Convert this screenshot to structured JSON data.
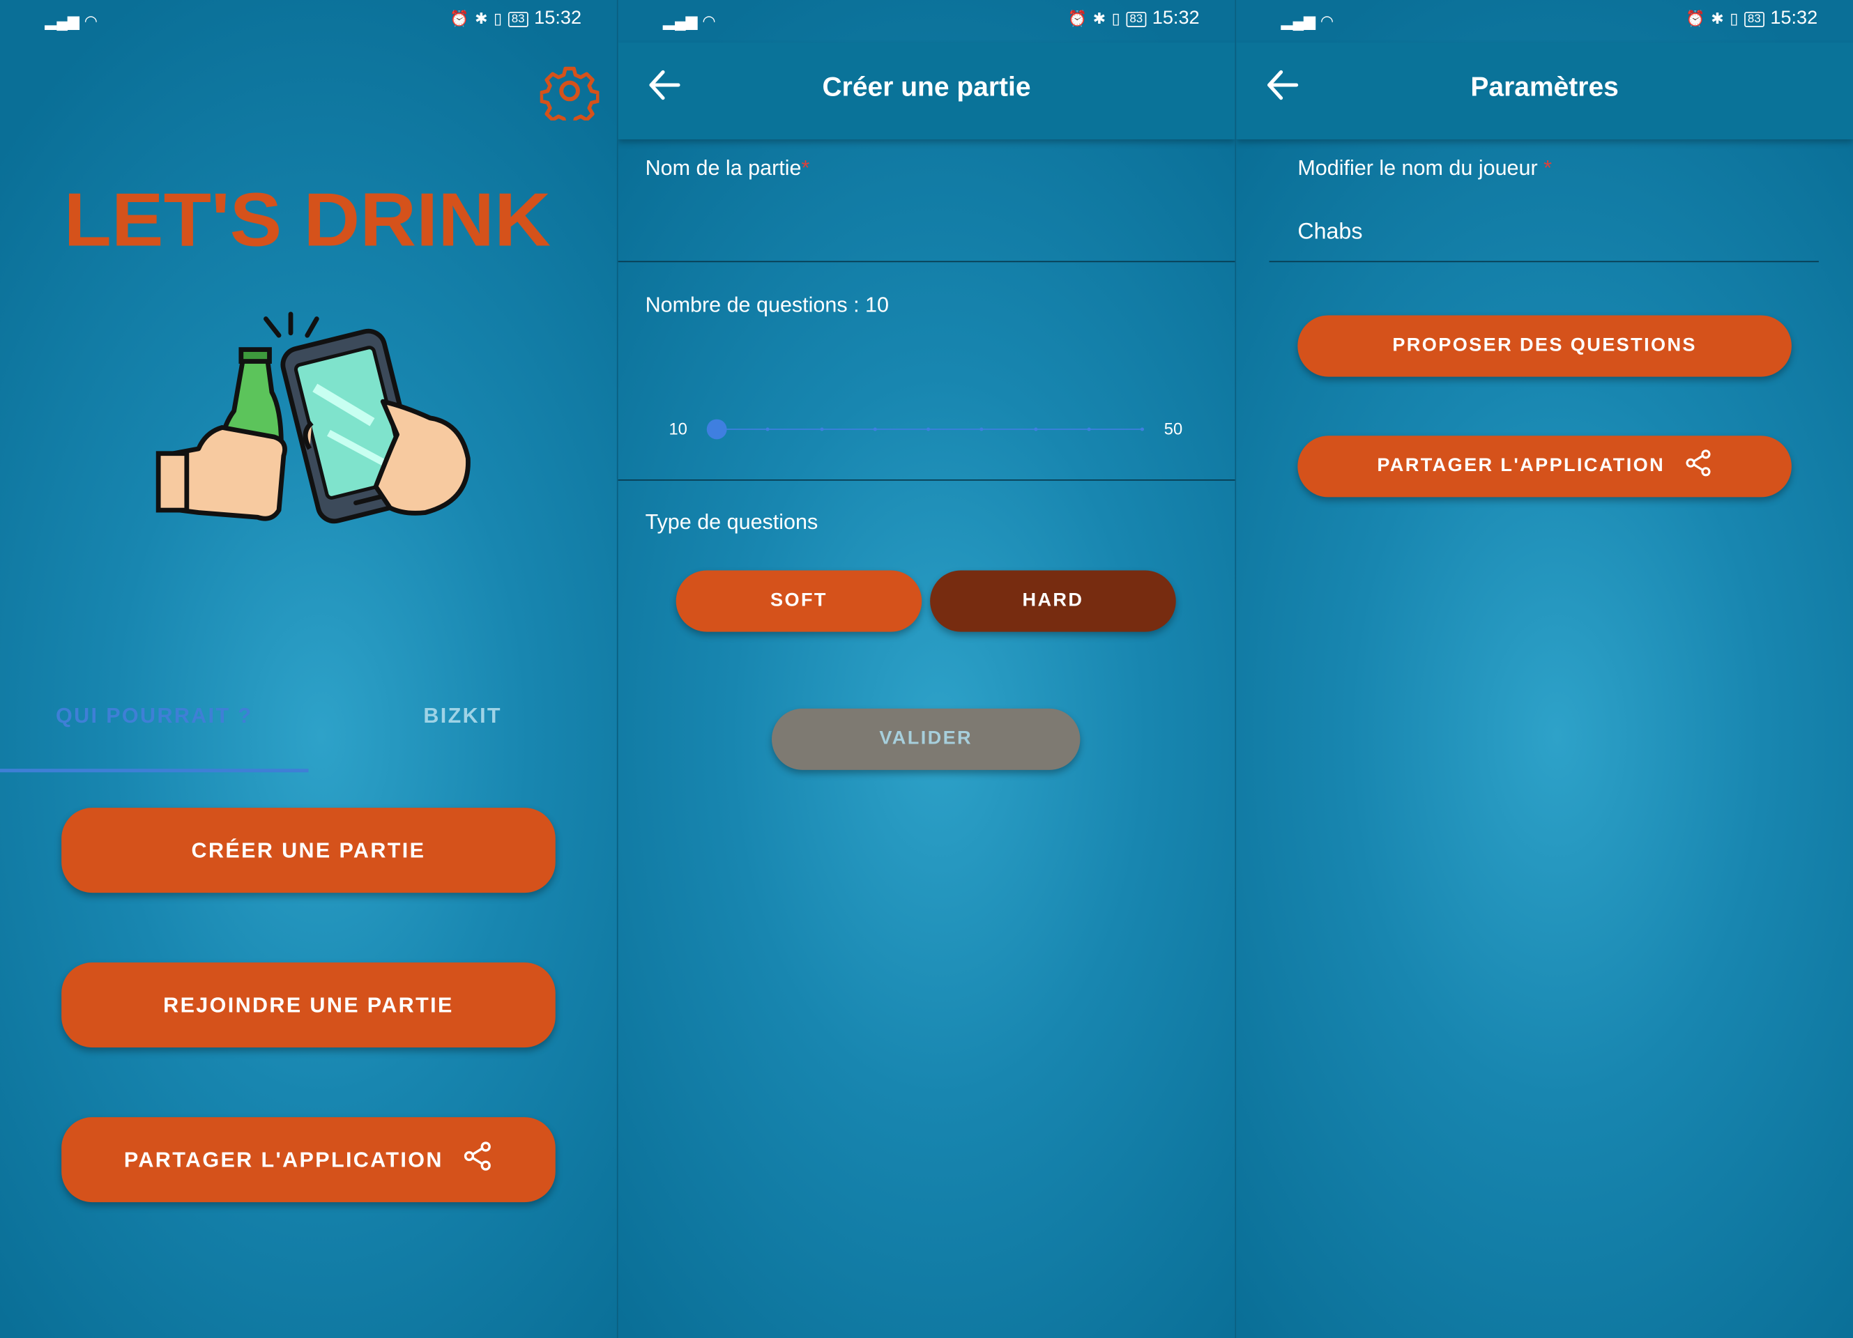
{
  "status_bar": {
    "time": "15:32",
    "battery": "83"
  },
  "icons": {
    "back": "arrow-left-icon",
    "settings": "gear-icon",
    "share": "share-icon",
    "signal": "signal-icon",
    "wifi": "wifi-icon",
    "alarm": "alarm-icon",
    "bluetooth": "bluetooth-icon",
    "vibrate": "vibrate-icon",
    "battery": "battery-icon"
  },
  "colors": {
    "accent": "#d5521b",
    "hard_button": "#772c10",
    "disabled_button": "#7e7a72",
    "appbar": "#0a7399",
    "tab_active": "#3f7fd6",
    "slider": "#3f7fe0"
  },
  "home": {
    "logo_text": "LET'S DRINK",
    "tabs": [
      {
        "label": "QUI POURRAIT ?",
        "selected": true
      },
      {
        "label": "BIZKIT",
        "selected": false
      }
    ],
    "create_button": "CRÉER UNE PARTIE",
    "join_button": "REJOINDRE UNE PARTIE",
    "share_button": "PARTAGER L'APPLICATION"
  },
  "create_game": {
    "title": "Créer une partie",
    "name_label": "Nom de la partie",
    "name_required_mark": "*",
    "name_value": "",
    "questions_label": "Nombre de questions : 10",
    "slider": {
      "min_label": "10",
      "max_label": "50",
      "min": 10,
      "max": 50,
      "value": 10
    },
    "type_label": "Type de questions",
    "soft_button": "SOFT",
    "hard_button": "HARD",
    "validate_button": "VALIDER"
  },
  "settings": {
    "title": "Paramètres",
    "player_label": "Modifier le nom du joueur",
    "player_required_mark": "*",
    "player_value": "Chabs",
    "propose_button": "PROPOSER DES QUESTIONS",
    "share_button": "PARTAGER L'APPLICATION"
  }
}
